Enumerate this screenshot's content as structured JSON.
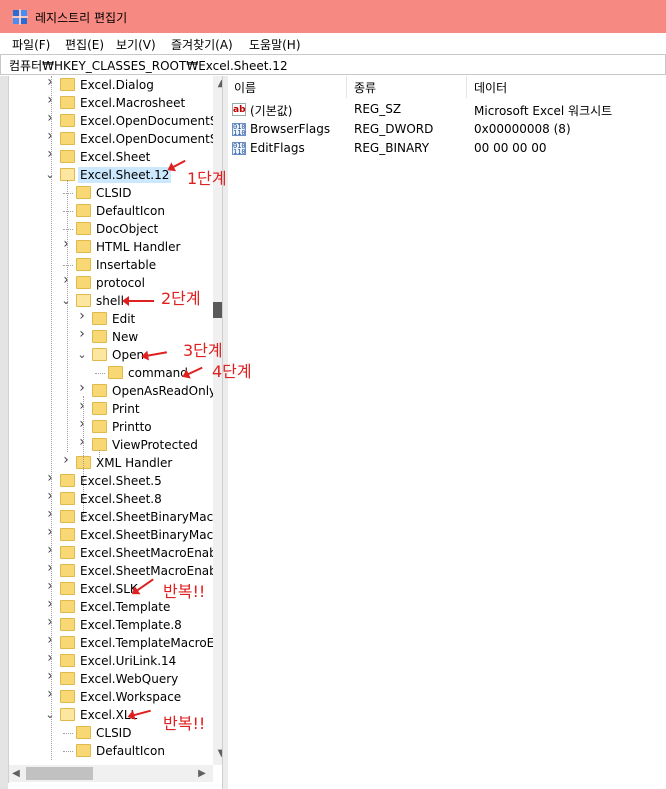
{
  "window": {
    "title": "레지스트리 편집기"
  },
  "menu": [
    "파일(F)",
    "편집(E)",
    "보기(V)",
    "즐겨찾기(A)",
    "도움말(H)"
  ],
  "address": "컴퓨터₩HKEY_CLASSES_ROOT₩Excel.Sheet.12",
  "tree": [
    {
      "label": "Excel.Dialog",
      "level": 0,
      "expander": "collapsed"
    },
    {
      "label": "Excel.Macrosheet",
      "level": 0,
      "expander": "collapsed"
    },
    {
      "label": "Excel.OpenDocumentS",
      "level": 0,
      "expander": "collapsed"
    },
    {
      "label": "Excel.OpenDocumentS",
      "level": 0,
      "expander": "collapsed"
    },
    {
      "label": "Excel.Sheet",
      "level": 0,
      "expander": "collapsed"
    },
    {
      "label": "Excel.Sheet.12",
      "level": 0,
      "expander": "expanded",
      "selected": true
    },
    {
      "label": "CLSID",
      "level": 1,
      "expander": "none"
    },
    {
      "label": "DefaultIcon",
      "level": 1,
      "expander": "none"
    },
    {
      "label": "DocObject",
      "level": 1,
      "expander": "none"
    },
    {
      "label": "HTML Handler",
      "level": 1,
      "expander": "collapsed"
    },
    {
      "label": "Insertable",
      "level": 1,
      "expander": "none"
    },
    {
      "label": "protocol",
      "level": 1,
      "expander": "collapsed"
    },
    {
      "label": "shell",
      "level": 1,
      "expander": "expanded"
    },
    {
      "label": "Edit",
      "level": 2,
      "expander": "collapsed"
    },
    {
      "label": "New",
      "level": 2,
      "expander": "collapsed"
    },
    {
      "label": "Open",
      "level": 2,
      "expander": "expanded"
    },
    {
      "label": "command",
      "level": 3,
      "expander": "none"
    },
    {
      "label": "OpenAsReadOnly",
      "level": 2,
      "expander": "collapsed"
    },
    {
      "label": "Print",
      "level": 2,
      "expander": "collapsed"
    },
    {
      "label": "Printto",
      "level": 2,
      "expander": "collapsed"
    },
    {
      "label": "ViewProtected",
      "level": 2,
      "expander": "collapsed"
    },
    {
      "label": "XML Handler",
      "level": 1,
      "expander": "collapsed"
    },
    {
      "label": "Excel.Sheet.5",
      "level": 0,
      "expander": "collapsed"
    },
    {
      "label": "Excel.Sheet.8",
      "level": 0,
      "expander": "collapsed"
    },
    {
      "label": "Excel.SheetBinaryMacro",
      "level": 0,
      "expander": "collapsed"
    },
    {
      "label": "Excel.SheetBinaryMacro",
      "level": 0,
      "expander": "collapsed"
    },
    {
      "label": "Excel.SheetMacroEnabl",
      "level": 0,
      "expander": "collapsed"
    },
    {
      "label": "Excel.SheetMacroEnabl",
      "level": 0,
      "expander": "collapsed"
    },
    {
      "label": "Excel.SLK",
      "level": 0,
      "expander": "collapsed"
    },
    {
      "label": "Excel.Template",
      "level": 0,
      "expander": "collapsed"
    },
    {
      "label": "Excel.Template.8",
      "level": 0,
      "expander": "collapsed"
    },
    {
      "label": "Excel.TemplateMacroEr",
      "level": 0,
      "expander": "collapsed"
    },
    {
      "label": "Excel.UriLink.14",
      "level": 0,
      "expander": "collapsed"
    },
    {
      "label": "Excel.WebQuery",
      "level": 0,
      "expander": "collapsed"
    },
    {
      "label": "Excel.Workspace",
      "level": 0,
      "expander": "collapsed"
    },
    {
      "label": "Excel.XLL",
      "level": 0,
      "expander": "expanded"
    },
    {
      "label": "CLSID",
      "level": 1,
      "expander": "none"
    },
    {
      "label": "DefaultIcon",
      "level": 1,
      "expander": "none"
    }
  ],
  "values": {
    "columns": [
      "이름",
      "종류",
      "데이터"
    ],
    "rows": [
      {
        "icon": "string-value-icon",
        "name": "(기본값)",
        "type": "REG_SZ",
        "data": "Microsoft Excel 워크시트"
      },
      {
        "icon": "binary-value-icon",
        "name": "BrowserFlags",
        "type": "REG_DWORD",
        "data": "0x00000008 (8)"
      },
      {
        "icon": "binary-value-icon",
        "name": "EditFlags",
        "type": "REG_BINARY",
        "data": "00 00 00 00"
      }
    ]
  },
  "annotations": [
    "1단계",
    "2단계",
    "3단계",
    "4단계",
    "반복!!",
    "반복!!"
  ],
  "colors": {
    "titlebar": "#f68a82",
    "selection": "#cce8ff",
    "annotation": "#e02020",
    "folder": "#f8d775"
  }
}
